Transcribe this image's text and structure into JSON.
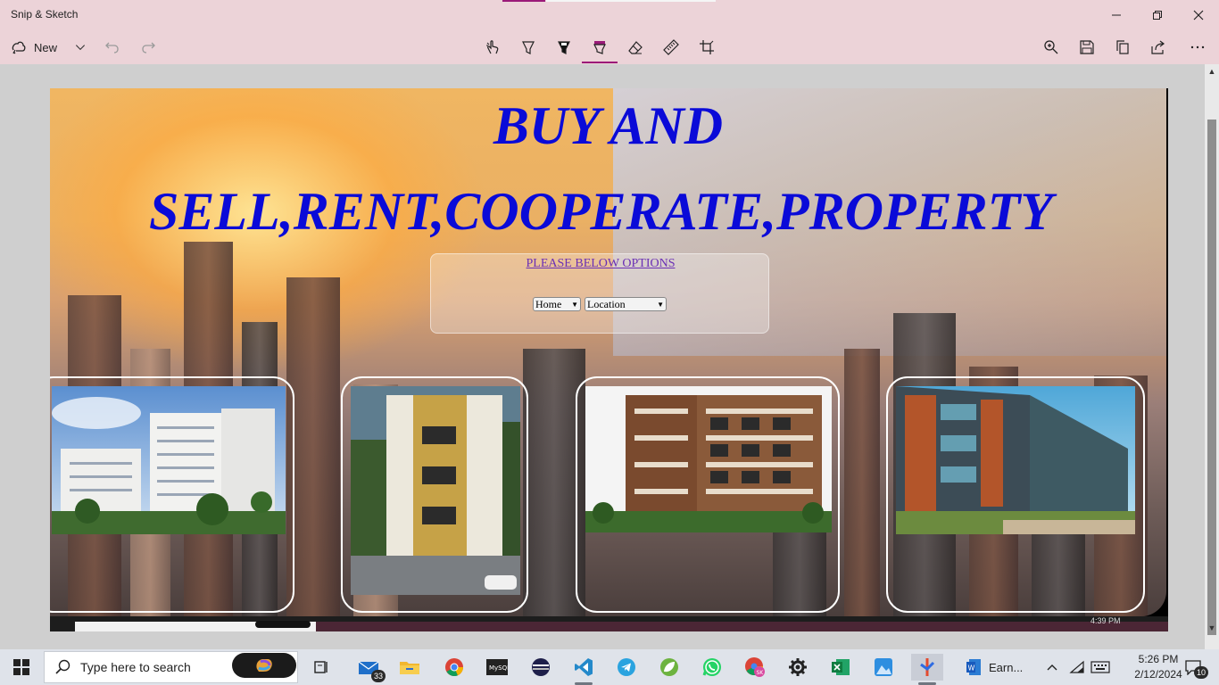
{
  "window": {
    "title": "Snip & Sketch"
  },
  "toolbar": {
    "new_label": "New",
    "icons": [
      "undo-icon",
      "redo-icon",
      "touch-writing-icon",
      "ballpoint-pen-icon",
      "pencil-icon",
      "highlighter-icon",
      "eraser-icon",
      "ruler-icon",
      "crop-icon",
      "zoom-icon",
      "save-icon",
      "copy-icon",
      "share-icon",
      "more-icon"
    ],
    "accent_color": "#9b1a78"
  },
  "page": {
    "headline_line1": "BUY AND",
    "headline_line2": "SELL,RENT,COOPERATE,PROPERTY",
    "options_link": "PLEASE BELOW OPTIONS",
    "select_home": "Home",
    "select_location": "Location",
    "headline_color": "#0a0ad8",
    "strip_time": "4:39 PM"
  },
  "cards": [
    {
      "label": "white-apartment-towers"
    },
    {
      "label": "yellow-trim-apartment"
    },
    {
      "label": "brown-apartment-block"
    },
    {
      "label": "modern-apartment-complex"
    }
  ],
  "taskbar": {
    "search_placeholder": "Type here to search",
    "mail_badge": "33",
    "earn_label": "Earn...",
    "time": "5:26 PM",
    "date": "2/12/2024",
    "notification_count": "10"
  }
}
